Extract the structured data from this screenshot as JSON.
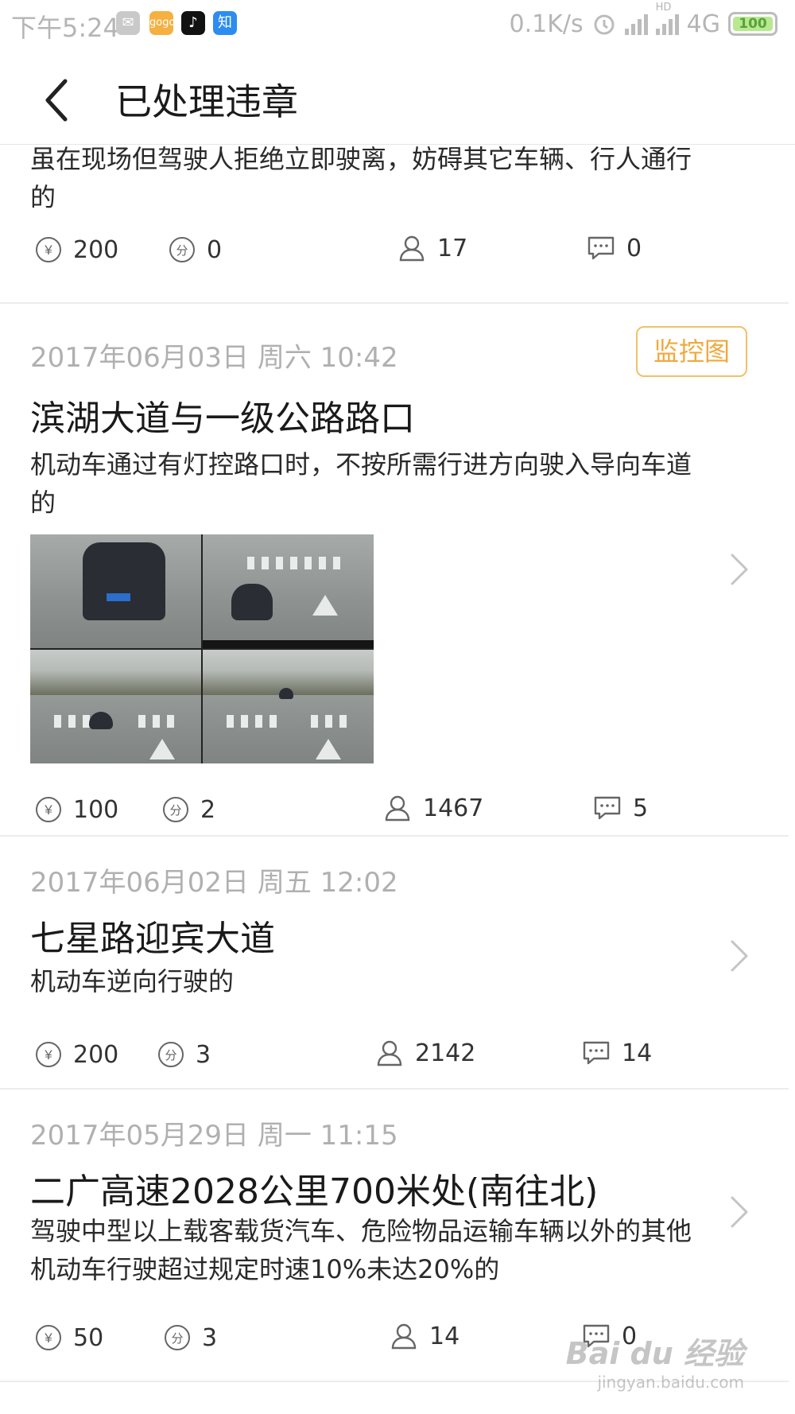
{
  "status_bar": {
    "time": "下午5:24",
    "network_speed": "0.1K/s",
    "network_type": "4G",
    "hd_label": "HD",
    "battery": "100",
    "app_icons": [
      {
        "name": "wechat-icon",
        "color": "#c9c9c9"
      },
      {
        "name": "taobao-icon",
        "color": "#f5b041",
        "label": "gogo"
      },
      {
        "name": "tiktok-icon",
        "color": "#111111"
      },
      {
        "name": "zhihu-icon",
        "color": "#2d8cf0",
        "label": "知"
      }
    ]
  },
  "header": {
    "title": "已处理违章",
    "back_icon": "chevron-left-icon"
  },
  "records": [
    {
      "date": "",
      "location": "",
      "description": "虽在现场但驾驶人拒绝立即驶离，妨碍其它车辆、行人通行的",
      "fine": "200",
      "points": "0",
      "views": "17",
      "comments": "0"
    },
    {
      "date": "2017年06月03日 周六 10:42",
      "location": "滨湖大道与一级公路路口",
      "description": "机动车通过有灯控路口时，不按所需行进方向驶入导向车道的",
      "monitor_label": "监控图",
      "fine": "100",
      "points": "2",
      "views": "1467",
      "comments": "5"
    },
    {
      "date": "2017年06月02日 周五 12:02",
      "location": "七星路迎宾大道",
      "description": "机动车逆向行驶的",
      "fine": "200",
      "points": "3",
      "views": "2142",
      "comments": "14"
    },
    {
      "date": "2017年05月29日 周一 11:15",
      "location": "二广高速2028公里700米处(南往北)",
      "description": "驾驶中型以上载客载货汽车、危险物品运输车辆以外的其他机动车行驶超过规定时速10%未达20%的",
      "fine": "50",
      "points": "3",
      "views": "14",
      "comments": "0"
    }
  ],
  "icons": {
    "fine": "yuan-icon",
    "points": "points-icon",
    "views": "user-icon",
    "comments": "comment-icon",
    "more": "chevron-right-icon"
  },
  "icon_glyphs": {
    "fine": "¥",
    "points": "分"
  },
  "colors": {
    "accent_orange": "#f0a93c",
    "date_gray": "#b0b0b0",
    "text_dark": "#1a1a1a"
  },
  "watermark": {
    "logo": "Bai du 经验",
    "url": "jingyan.baidu.com"
  }
}
